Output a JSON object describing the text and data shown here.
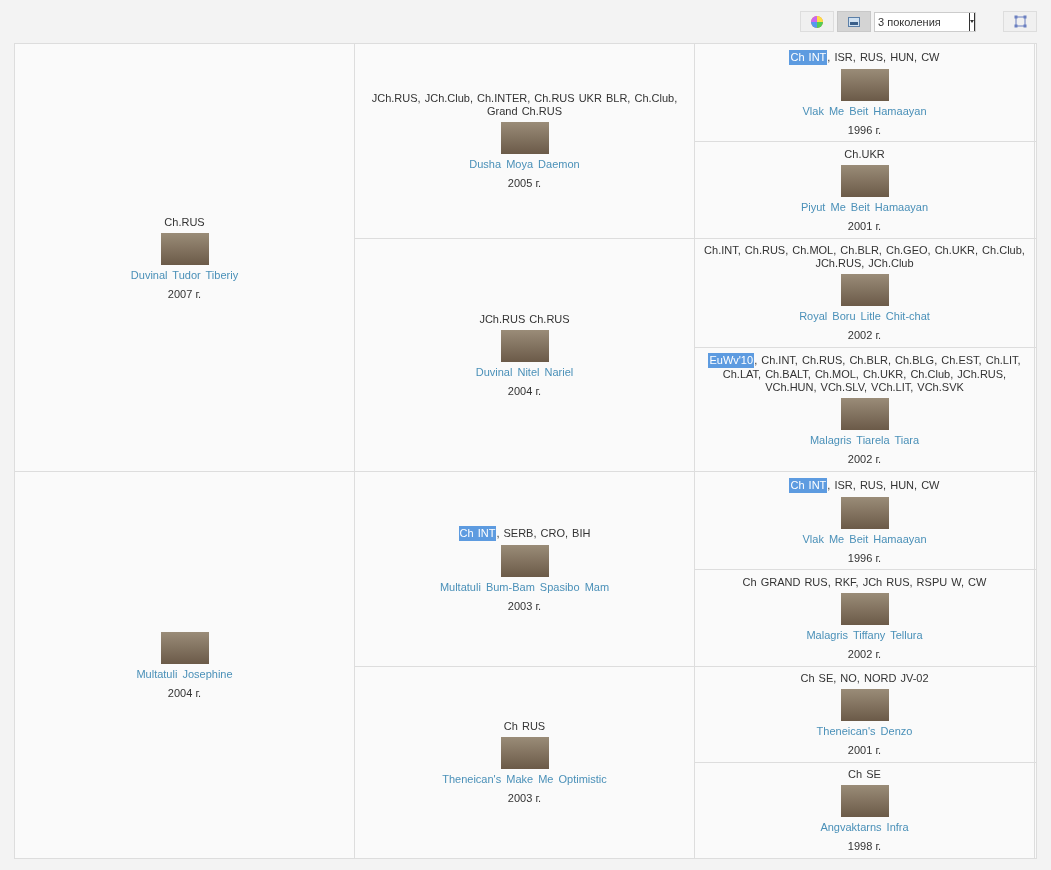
{
  "toolbar": {
    "buttons": [
      {
        "kind": "color",
        "selected": false
      },
      {
        "kind": "image",
        "selected": true
      }
    ],
    "generations_select": {
      "value": "3 поколения"
    }
  },
  "pedigree": [
    {
      "titles": {
        "text": "Ch.RUS"
      },
      "name": "Duvinal Tudor Tiberiy",
      "year": "2007 г.",
      "children": [
        {
          "titles": {
            "text": "JCh.RUS, JCh.Club, Ch.INTER, Ch.RUS UKR BLR, Ch.Club, Grand Ch.RUS"
          },
          "name": "Dusha Moya Daemon",
          "year": "2005 г.",
          "children": [
            {
              "titles": {
                "badge": "Ch INT",
                "text": ", ISR, RUS, HUN, CW"
              },
              "name": "Vlak Me Beit Hamaayan",
              "year": "1996 г."
            },
            {
              "titles": {
                "text": "Ch.UKR"
              },
              "name": "Piyut Me Beit Hamaayan",
              "year": "2001 г."
            }
          ]
        },
        {
          "titles": {
            "text": "JCh.RUS Ch.RUS"
          },
          "name": "Duvinal Nitel Nariel",
          "year": "2004 г.",
          "children": [
            {
              "titles": {
                "text": "Ch.INT, Ch.RUS, Ch.MOL, Ch.BLR, Ch.GEO, Ch.UKR, Ch.Club, JCh.RUS, JCh.Club"
              },
              "name": "Royal Boru Litle Chit-chat",
              "year": "2002 г."
            },
            {
              "titles": {
                "badge": "EuWv'10",
                "text": ", Ch.INT, Ch.RUS, Ch.BLR, Ch.BLG, Ch.EST, Ch.LIT, Ch.LAT, Ch.BALT, Ch.MOL, Ch.UKR, Ch.Club, JCh.RUS, VCh.HUN, VCh.SLV, VCh.LIT, VCh.SVK"
              },
              "name": "Malagris Tiarela Tiara",
              "year": "2002 г."
            }
          ]
        }
      ]
    },
    {
      "name": "Multatuli Josephine",
      "year": "2004 г.",
      "children": [
        {
          "titles": {
            "badge": "Ch INT",
            "text": ", SERB, CRO, BIH"
          },
          "name": "Multatuli Bum-Bam Spasibo Mam",
          "year": "2003 г.",
          "children": [
            {
              "titles": {
                "badge": "Ch INT",
                "text": ", ISR, RUS, HUN, CW"
              },
              "name": "Vlak Me Beit Hamaayan",
              "year": "1996 г."
            },
            {
              "titles": {
                "text": "Ch GRAND RUS, RKF, JCh RUS, RSPU W, CW"
              },
              "name": "Malagris Tiffany Tellura",
              "year": "2002 г."
            }
          ]
        },
        {
          "titles": {
            "text": "Ch RUS"
          },
          "name": "Theneican's Make Me Optimistic",
          "year": "2003 г.",
          "children": [
            {
              "titles": {
                "text": "Ch SE, NO, NORD JV-02"
              },
              "name": "Theneican's Denzo",
              "year": "2001 г."
            },
            {
              "titles": {
                "text": "Ch SE"
              },
              "name": "Angvaktarns Infra",
              "year": "1998 г."
            }
          ]
        }
      ]
    }
  ]
}
